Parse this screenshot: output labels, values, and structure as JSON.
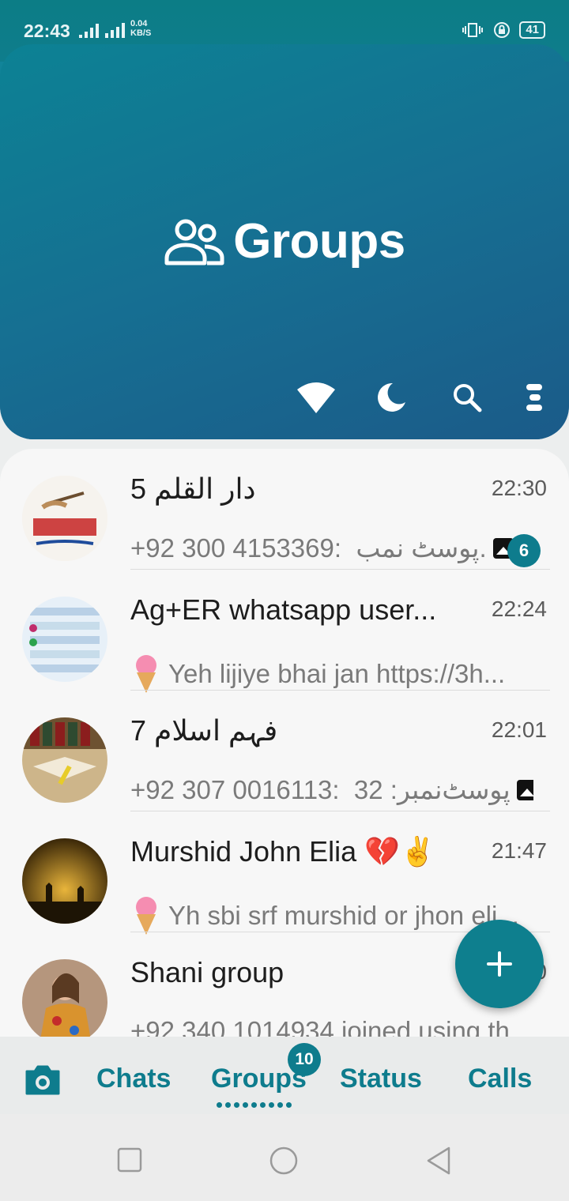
{
  "status_bar": {
    "time": "22:43",
    "network": "4G",
    "speed_value": "0.04",
    "speed_unit": "KB/S",
    "battery": "41"
  },
  "header": {
    "title": "Groups",
    "icons": [
      "groups-icon",
      "wifi-icon",
      "moon-icon",
      "search-icon",
      "menu-icon"
    ]
  },
  "chats": [
    {
      "title": "دار القلم 5",
      "time": "22:30",
      "preview": "+92 300 4153369:  پوسٹ نمب.",
      "has_image": true,
      "unread": "6"
    },
    {
      "title": "Ag+ER whatsapp user...",
      "time": "22:24",
      "preview": "Yeh lijiye bhai jan  https://3h...",
      "has_icecream": true
    },
    {
      "title": "فہمِ اسلام 7",
      "time": "22:01",
      "preview": "+92 307 0016113:  32 :پوسٹ‌نمبر",
      "has_image": true
    },
    {
      "title": "Murshid John Elia 💔✌️",
      "time": "21:47",
      "preview": "Yh sbi srf murshid or jhon eli...",
      "has_icecream": true
    },
    {
      "title": "Shani group",
      "time": "20",
      "preview": "+92 340 1014934 joined using th..."
    }
  ],
  "fab": {
    "icon": "plus-icon"
  },
  "bottom_nav": {
    "camera": "camera-icon",
    "chats": "Chats",
    "groups": "Groups",
    "groups_badge": "10",
    "status": "Status",
    "calls": "Calls"
  },
  "colors": {
    "accent": "#0e7c8d",
    "header_start": "#0c8294",
    "header_end": "#1b5b89"
  }
}
